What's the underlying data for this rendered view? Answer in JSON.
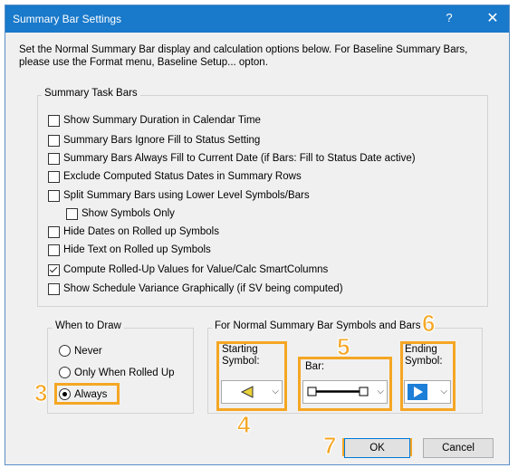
{
  "window": {
    "title": "Summary Bar Settings",
    "help_glyph": "?",
    "close_glyph": "✕"
  },
  "intro_text": "Set the Normal Summary Bar display and calculation options below. For Baseline Summary Bars, please use the Format menu, Baseline Setup... opton.",
  "summary_group": {
    "label": "Summary Task Bars",
    "options": [
      {
        "label": "Show Summary Duration in Calendar Time",
        "checked": false
      },
      {
        "label": "Summary Bars Ignore Fill to Status Setting",
        "checked": false
      },
      {
        "label": "Summary Bars Always Fill to Current Date (if Bars: Fill to Status Date active)",
        "checked": false
      },
      {
        "label": "Exclude Computed Status Dates in Summary Rows",
        "checked": false
      },
      {
        "label": "Split Summary Bars using Lower Level Symbols/Bars",
        "checked": false
      },
      {
        "label": "Show Symbols Only",
        "checked": false
      },
      {
        "label": "Hide Dates on Rolled up Symbols",
        "checked": false
      },
      {
        "label": "Hide Text on Rolled up Symbols",
        "checked": false
      },
      {
        "label": "Compute Rolled-Up Values for Value/Calc SmartColumns",
        "checked": true
      },
      {
        "label": "Show Schedule Variance Graphically (if SV being computed)",
        "checked": false
      }
    ]
  },
  "when_to_draw": {
    "label": "When to Draw",
    "options": [
      {
        "label": "Never",
        "selected": false
      },
      {
        "label": "Only When Rolled Up",
        "selected": false
      },
      {
        "label": "Always",
        "selected": true
      }
    ]
  },
  "symbols_group": {
    "label": "For Normal Summary Bar Symbols and Bars",
    "starting_label": "Starting Symbol:",
    "bar_label": "Bar:",
    "ending_label": "Ending Symbol:"
  },
  "callouts": [
    "3",
    "4",
    "5",
    "6",
    "7"
  ],
  "buttons": {
    "ok": "OK",
    "cancel": "Cancel"
  },
  "colors": {
    "titlebar": "#1979ca",
    "highlight": "#f5a623",
    "start_symbol": "#e8d23a",
    "end_symbol": "#1e7fd8"
  },
  "icons": {
    "chevron": "⌵"
  }
}
